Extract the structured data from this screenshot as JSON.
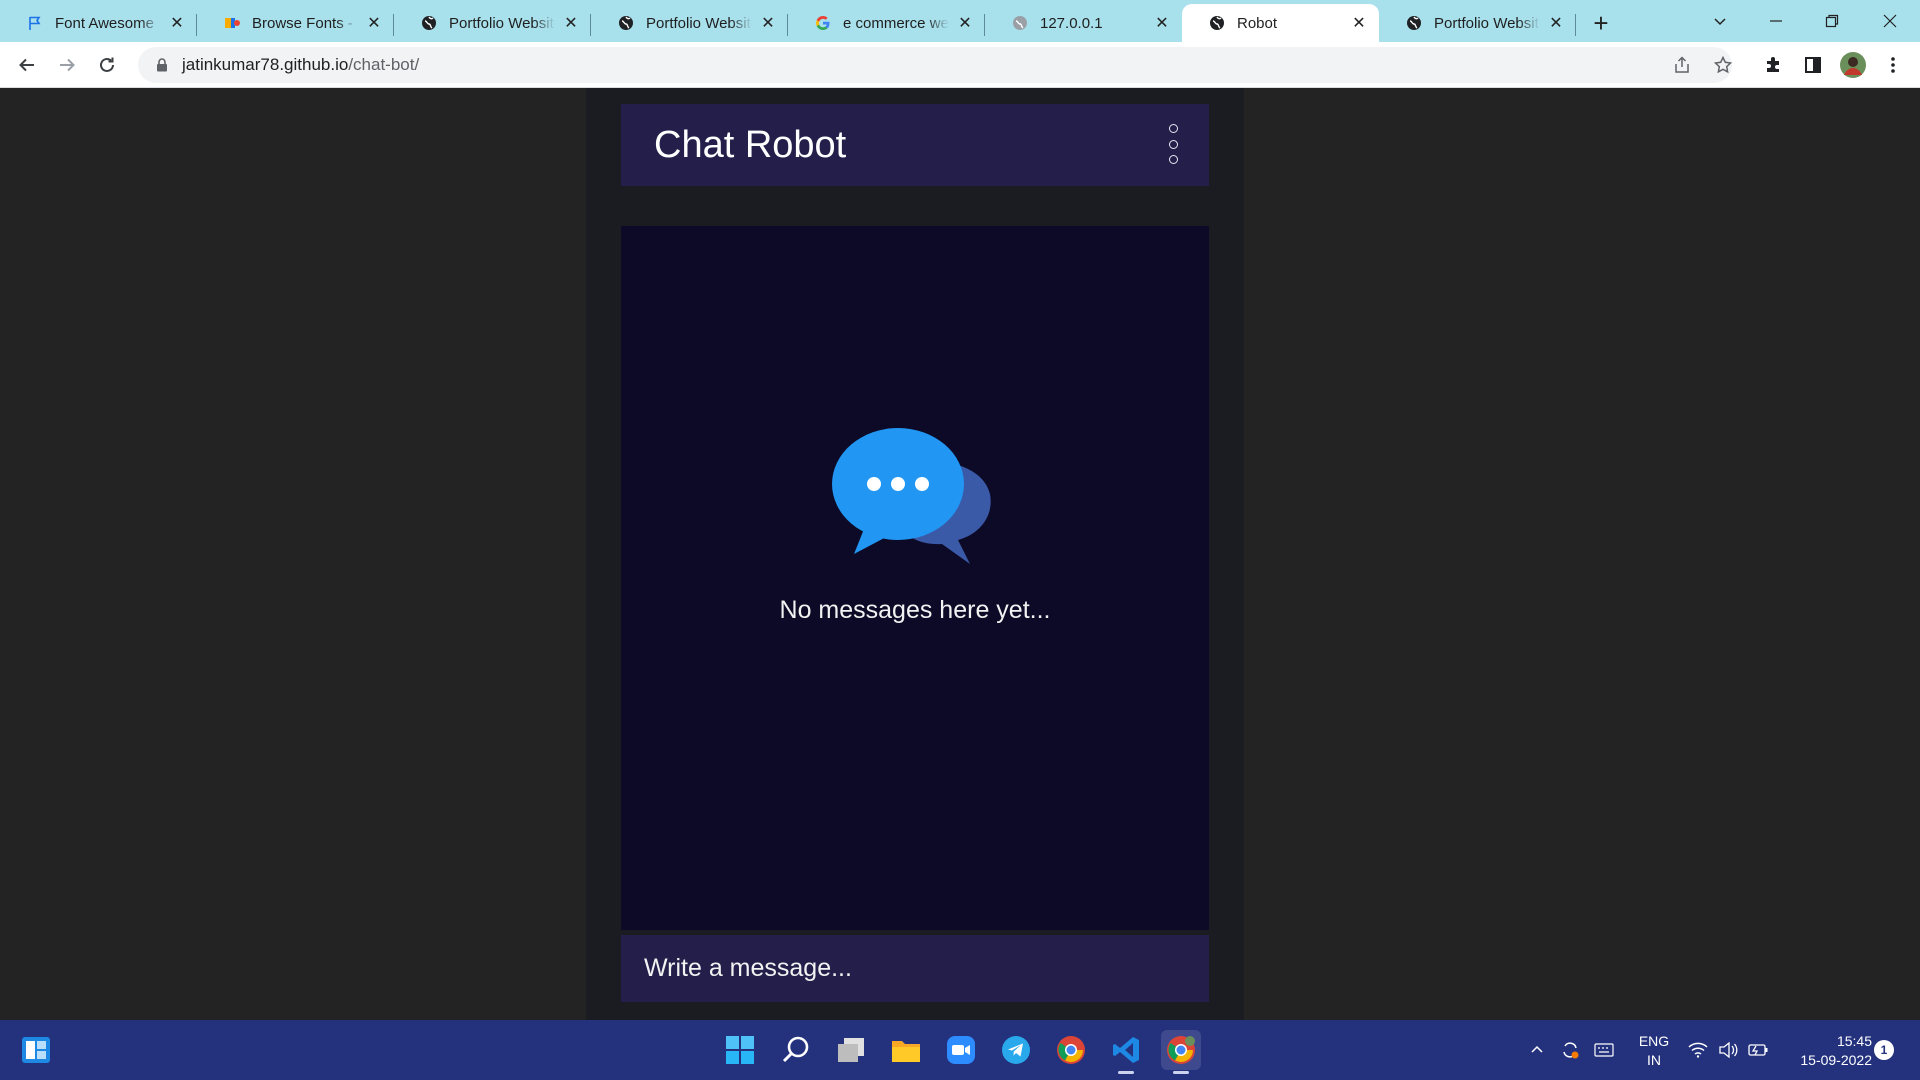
{
  "browser": {
    "tabs": [
      {
        "title": "Font Awesome",
        "favicon": "flag-icon",
        "active": false
      },
      {
        "title": "Browse Fonts - Google Fonts",
        "favicon": "google-fonts-icon",
        "active": false
      },
      {
        "title": "Portfolio Website",
        "favicon": "globe-icon",
        "active": false
      },
      {
        "title": "Portfolio Website",
        "favicon": "globe-icon",
        "active": false
      },
      {
        "title": "e commerce website",
        "favicon": "google-icon",
        "active": false
      },
      {
        "title": "127.0.0.1",
        "favicon": "globe-gray-icon",
        "active": false
      },
      {
        "title": "Robot",
        "favicon": "globe-icon",
        "active": true
      },
      {
        "title": "Portfolio Website",
        "favicon": "globe-icon",
        "active": false
      }
    ],
    "url_host": "jatinkumar78.github.io",
    "url_path": "/chat-bot/"
  },
  "app": {
    "title": "Chat Robot",
    "empty_text": "No messages here yet...",
    "composer_placeholder": "Write a message...",
    "colors": {
      "header": "#231f4a",
      "chat_bg": "#0c0a26",
      "bubble_front": "#2196f3",
      "bubble_back": "#3a5aa8"
    }
  },
  "taskbar": {
    "apps": [
      "start-icon",
      "search-icon",
      "task-view-icon",
      "file-explorer-icon",
      "zoom-icon",
      "telegram-icon",
      "chrome-icon",
      "vscode-icon",
      "chrome-profile-icon"
    ],
    "lang_line1": "ENG",
    "lang_line2": "IN",
    "time": "15:45",
    "date": "15-09-2022",
    "notification_count": "1"
  }
}
